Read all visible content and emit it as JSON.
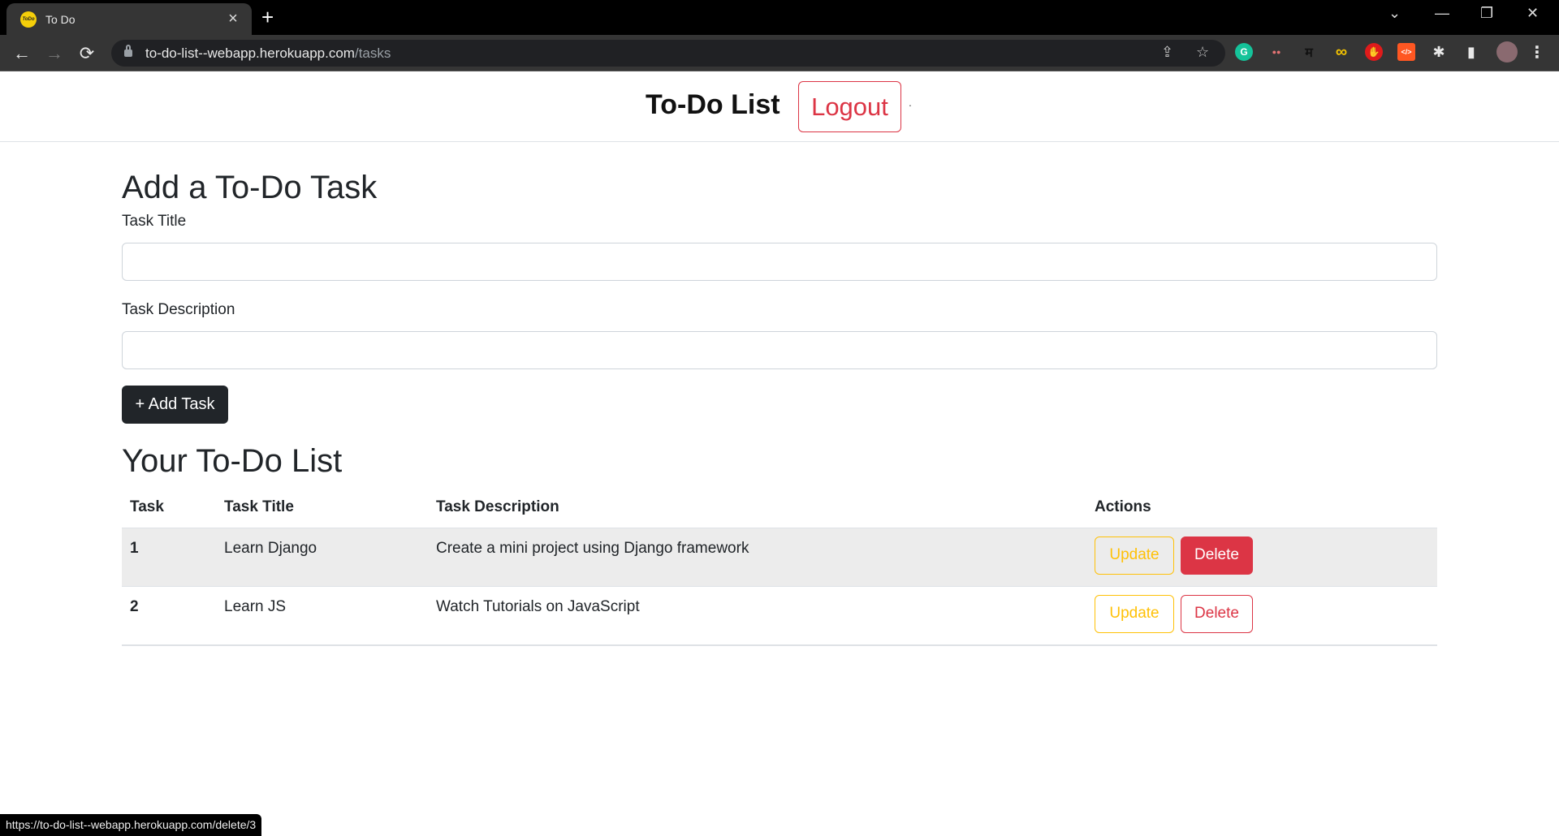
{
  "browser": {
    "tab_title": "To Do",
    "favicon_text": "ToDo",
    "tab_close": "×",
    "new_tab": "+",
    "url_host": "to-do-list--webapp.herokuapp.com",
    "url_path": "/tasks",
    "status_url": "https://to-do-list--webapp.herokuapp.com/delete/3",
    "icons": {
      "back": "←",
      "forward": "→",
      "reload": "⟳",
      "share": "⇪",
      "star": "☆",
      "tab_search": "⌄",
      "minimize": "—",
      "restore": "❐",
      "close": "✕",
      "menu": "⋮"
    },
    "extensions": [
      {
        "name": "grammarly",
        "glyph": "G",
        "color": "#15c39a"
      },
      {
        "name": "glasses",
        "glyph": "●●",
        "color": "#e57373"
      },
      {
        "name": "hindi",
        "glyph": "म",
        "color": "#111"
      },
      {
        "name": "infinity",
        "glyph": "∞",
        "color": "#f5c400"
      },
      {
        "name": "adblock",
        "glyph": "✋",
        "color": "#e01b1b"
      },
      {
        "name": "code",
        "glyph": "</>",
        "color": "#ff5722"
      },
      {
        "name": "puzzle",
        "glyph": "✱",
        "color": "#e8e8e8"
      },
      {
        "name": "sidepanel",
        "glyph": "▮",
        "color": "#e8e8e8"
      }
    ]
  },
  "header": {
    "brand": "To-Do List",
    "logout_label": "Logout",
    "dot": "."
  },
  "form": {
    "heading": "Add a To-Do Task",
    "title_label": "Task Title",
    "title_value": "",
    "description_label": "Task Description",
    "description_value": "",
    "add_button": "+ Add Task"
  },
  "list": {
    "heading": "Your To-Do List",
    "columns": [
      "Task",
      "Task Title",
      "Task Description",
      "Actions"
    ],
    "rows": [
      {
        "num": "1",
        "title": "Learn Django",
        "description": "Create a mini project using Django framework",
        "update": "Update",
        "delete": "Delete"
      },
      {
        "num": "2",
        "title": "Learn JS",
        "description": "Watch Tutorials on JavaScript",
        "update": "Update",
        "delete": "Delete"
      }
    ]
  },
  "colors": {
    "danger": "#dc3545",
    "warning": "#ffc107",
    "dark": "#212529"
  }
}
